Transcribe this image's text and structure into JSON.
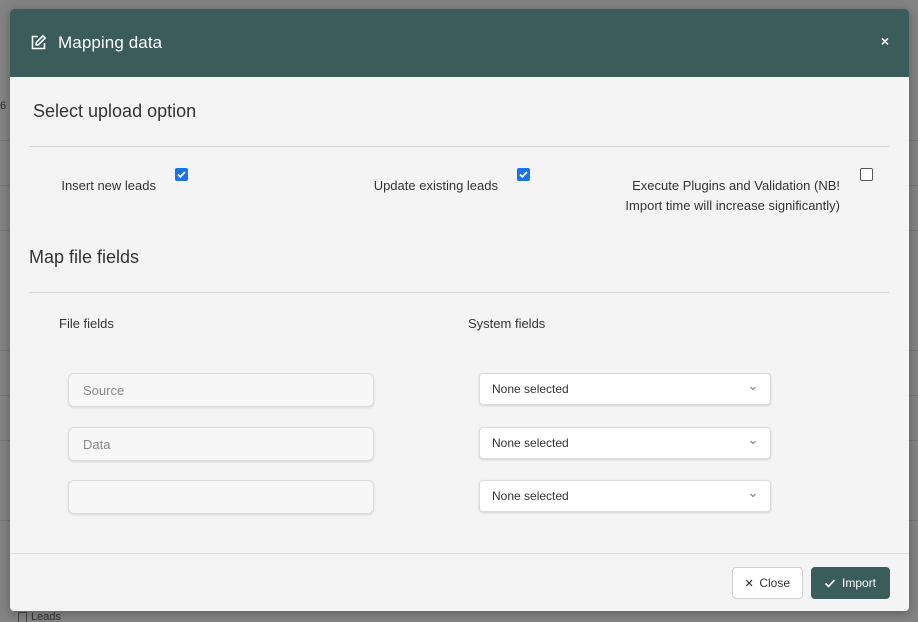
{
  "modal": {
    "title": "Mapping data",
    "close_symbol": "×"
  },
  "upload_options": {
    "title": "Select upload option",
    "options": [
      {
        "label": "Insert new leads",
        "checked": true
      },
      {
        "label": "Update existing leads",
        "checked": true
      },
      {
        "label_line1": "Execute Plugins and Validation (NB!",
        "label_line2": "Import time will increase significantly)",
        "checked": false
      }
    ]
  },
  "mapping": {
    "title": "Map file fields",
    "file_fields_label": "File fields",
    "system_fields_label": "System fields",
    "rows": [
      {
        "file_field_placeholder": "Source",
        "system_field": "None selected"
      },
      {
        "file_field_placeholder": "Data",
        "system_field": "None selected"
      },
      {
        "file_field_placeholder": "",
        "system_field": "None selected"
      }
    ]
  },
  "footer": {
    "close_label": "Close",
    "import_label": "Import"
  },
  "background": {
    "nav_label": "Leads",
    "fragment": "6"
  },
  "colors": {
    "header": "#3a5c5a",
    "checkbox_checked": "#1a73e8",
    "import_button": "#3a5c5a"
  },
  "icons": {
    "header": "edit-icon",
    "close": "close-icon",
    "checkbox_check": "check-icon",
    "dropdown": "chevron-down-icon",
    "import": "check-icon",
    "nav": "document-icon"
  }
}
